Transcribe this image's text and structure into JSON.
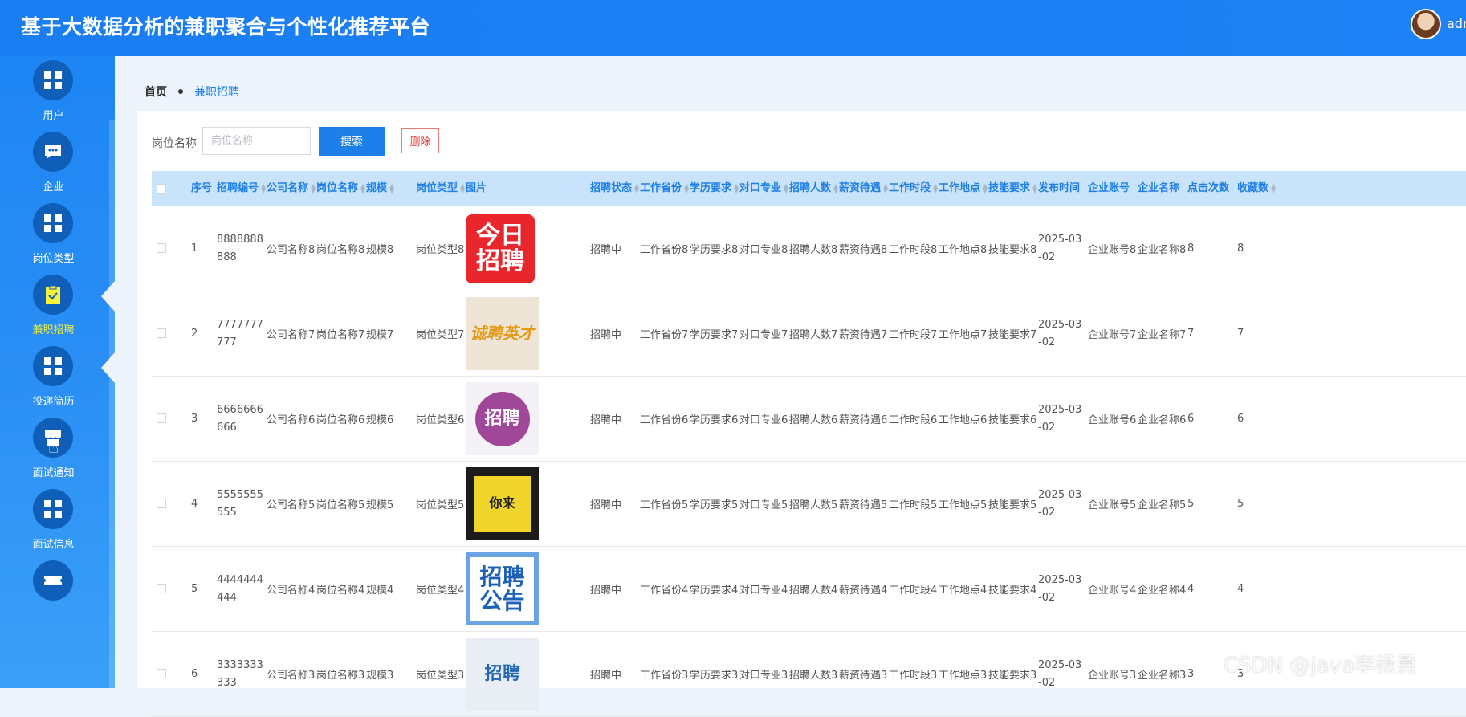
{
  "header": {
    "title": "基于大数据分析的兼职聚合与个性化推荐平台",
    "user": "adr"
  },
  "sidebar": {
    "items": [
      {
        "label": "用户",
        "icon": "grid-icon",
        "active": false
      },
      {
        "label": "企业",
        "icon": "chat-icon",
        "active": false
      },
      {
        "label": "岗位类型",
        "icon": "grid-icon",
        "active": false
      },
      {
        "label": "兼职招聘",
        "icon": "clipboard-check-icon",
        "active": true
      },
      {
        "label": "投递简历",
        "icon": "grid-icon",
        "active": false
      },
      {
        "label": "面试通知",
        "icon": "store-icon",
        "active": false
      },
      {
        "label": "面试信息",
        "icon": "grid-icon",
        "active": false
      },
      {
        "label": "",
        "icon": "ticket-icon",
        "active": false
      }
    ]
  },
  "breadcrumb": {
    "home": "首页",
    "current": "兼职招聘"
  },
  "search": {
    "label": "岗位名称",
    "placeholder": "岗位名称",
    "button": "搜索",
    "delete": "删除"
  },
  "table": {
    "headers": [
      "序号",
      "招聘编号",
      "公司名称",
      "岗位名称",
      "规模",
      "岗位类型",
      "图片",
      "招聘状态",
      "工作省份",
      "学历要求",
      "对口专业",
      "招聘人数",
      "薪资待遇",
      "工作时段",
      "工作地点",
      "技能要求",
      "发布时间",
      "企业账号",
      "企业名称",
      "点击次数",
      "收藏数"
    ],
    "rows": [
      {
        "no": "1",
        "code": "8888888888",
        "company": "公司名称8",
        "position": "岗位名称8",
        "scale": "规模8",
        "type": "岗位类型8",
        "image": "今日招聘",
        "status": "招聘中",
        "province": "工作省份8",
        "edu": "学历要求8",
        "major": "对口专业8",
        "count": "招聘人数8",
        "salary": "薪资待遇8",
        "period": "工作时段8",
        "place": "工作地点8",
        "skill": "技能要求8",
        "date": "2025-03-02",
        "account": "企业账号8",
        "ename": "企业名称8",
        "clicks": "8",
        "favs": "8"
      },
      {
        "no": "2",
        "code": "7777777777",
        "company": "公司名称7",
        "position": "岗位名称7",
        "scale": "规模7",
        "type": "岗位类型7",
        "image": "诚聘英才",
        "status": "招聘中",
        "province": "工作省份7",
        "edu": "学历要求7",
        "major": "对口专业7",
        "count": "招聘人数7",
        "salary": "薪资待遇7",
        "period": "工作时段7",
        "place": "工作地点7",
        "skill": "技能要求7",
        "date": "2025-03-02",
        "account": "企业账号7",
        "ename": "企业名称7",
        "clicks": "7",
        "favs": "7"
      },
      {
        "no": "3",
        "code": "6666666666",
        "company": "公司名称6",
        "position": "岗位名称6",
        "scale": "规模6",
        "type": "岗位类型6",
        "image": "招聘",
        "status": "招聘中",
        "province": "工作省份6",
        "edu": "学历要求6",
        "major": "对口专业6",
        "count": "招聘人数6",
        "salary": "薪资待遇6",
        "period": "工作时段6",
        "place": "工作地点6",
        "skill": "技能要求6",
        "date": "2025-03-02",
        "account": "企业账号6",
        "ename": "企业名称6",
        "clicks": "6",
        "favs": "6"
      },
      {
        "no": "4",
        "code": "5555555555",
        "company": "公司名称5",
        "position": "岗位名称5",
        "scale": "规模5",
        "type": "岗位类型5",
        "image": "你来",
        "status": "招聘中",
        "province": "工作省份5",
        "edu": "学历要求5",
        "major": "对口专业5",
        "count": "招聘人数5",
        "salary": "薪资待遇5",
        "period": "工作时段5",
        "place": "工作地点5",
        "skill": "技能要求5",
        "date": "2025-03-02",
        "account": "企业账号5",
        "ename": "企业名称5",
        "clicks": "5",
        "favs": "5"
      },
      {
        "no": "5",
        "code": "4444444444",
        "company": "公司名称4",
        "position": "岗位名称4",
        "scale": "规模4",
        "type": "岗位类型4",
        "image": "招聘公告",
        "status": "招聘中",
        "province": "工作省份4",
        "edu": "学历要求4",
        "major": "对口专业4",
        "count": "招聘人数4",
        "salary": "薪资待遇4",
        "period": "工作时段4",
        "place": "工作地点4",
        "skill": "技能要求4",
        "date": "2025-03-02",
        "account": "企业账号4",
        "ename": "企业名称4",
        "clicks": "4",
        "favs": "4"
      },
      {
        "no": "6",
        "code": "3333333333",
        "company": "公司名称3",
        "position": "岗位名称3",
        "scale": "规模3",
        "type": "岗位类型3",
        "image": "招聘",
        "status": "招聘中",
        "province": "工作省份3",
        "edu": "学历要求3",
        "major": "对口专业3",
        "count": "招聘人数3",
        "salary": "薪资待遇3",
        "period": "工作时段3",
        "place": "工作地点3",
        "skill": "技能要求3",
        "date": "2025-03-02",
        "account": "企业账号3",
        "ename": "企业名称3",
        "clicks": "3",
        "favs": "3"
      }
    ]
  },
  "watermark": "CSDN @java李杨勇",
  "colors": {
    "primary": "#1f7fe8",
    "header_bg": "#c9e3fb",
    "active_label": "#f8f23a",
    "danger": "#d9342b"
  }
}
